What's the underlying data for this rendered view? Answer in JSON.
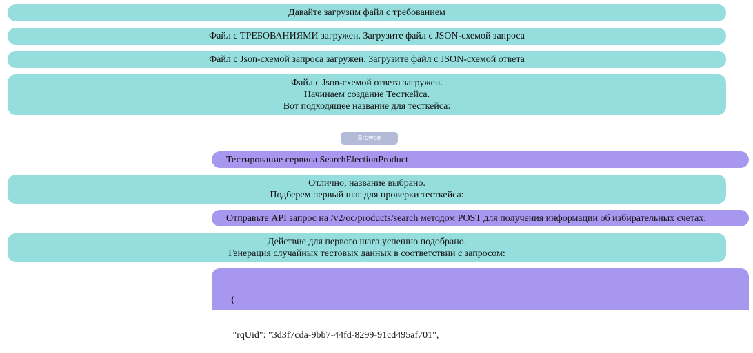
{
  "chat": {
    "bot_1": "Давайте загрузим файл с требованием",
    "bot_2": "Файл с ТРЕБОВАНИЯМИ загружен. Загрузите файл с JSON-схемой запроса",
    "bot_3": "Файл с Json-схемой запроса загружен. Загрузите файл с JSON-схемой ответа",
    "bot_4": {
      "line_1": "Файл с Json-схемой ответа загружен.",
      "line_2": "Начинаем создание Тесткейса.",
      "line_3": "Вот подходящее название для тесткейса:"
    },
    "browse_label": "Browse",
    "user_1": "Тестирование сервиса SearchElectionProduct",
    "bot_5": {
      "line_1": "Отлично, название выбрано.",
      "line_2": "Подберем первый шаг для проверки тесткейса:"
    },
    "user_2": "Отправьте API запрос на /v2/oc/products/search методом POST для получения информации об избирательных счетах.",
    "bot_6": {
      "line_1": "Действие для первого шага успешно подобрано.",
      "line_2": "Генерация случайных тестовых данных в соответствии с запросом:"
    },
    "user_3": {
      "line_1": "  {",
      "line_2": "   \"rqUid\": \"3d3f7cda-9bb7-44fd-8299-91cd495af701\","
    }
  },
  "colors": {
    "bot_bubble": "#96dede",
    "user_bubble": "#a897ef",
    "browse_button": "#b3bbd9"
  }
}
